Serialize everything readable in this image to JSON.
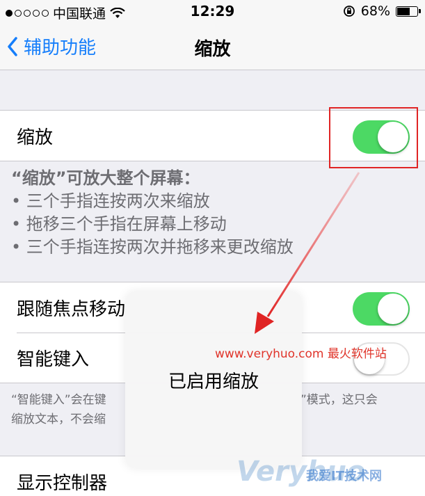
{
  "status_bar": {
    "carrier": "中国联通",
    "time": "12:29",
    "battery": "68%",
    "battery_level": 0.68
  },
  "nav": {
    "back_label": "辅助功能",
    "title": "缩放"
  },
  "zoom": {
    "label": "缩放",
    "enabled": true
  },
  "zoom_footer": {
    "intro": "“缩放”可放大整个屏幕：",
    "bullets": [
      "• 三个手指连按两次来缩放",
      "• 拖移三个手指在屏幕上移动",
      "• 三个手指连按两次并拖移来更改缩放"
    ]
  },
  "follow_focus": {
    "label": "跟随焦点移动",
    "enabled": true
  },
  "smart_typing": {
    "label": "智能键入",
    "enabled": false
  },
  "smart_footer": {
    "line1_start": "“智能键入”会在键",
    "line1_end": "”模式，这只会",
    "line2": "缩放文本，不会缩"
  },
  "show_controller": {
    "label": "显示控制器"
  },
  "hud": {
    "message": "已启用缩放"
  },
  "annotations": {
    "site_watermark": "www.veryhuo.com 最火软件站",
    "logo_text": "Veryhuo",
    "logo_text_2": "我爱IT技术网",
    "accent_color": "#e02424"
  }
}
